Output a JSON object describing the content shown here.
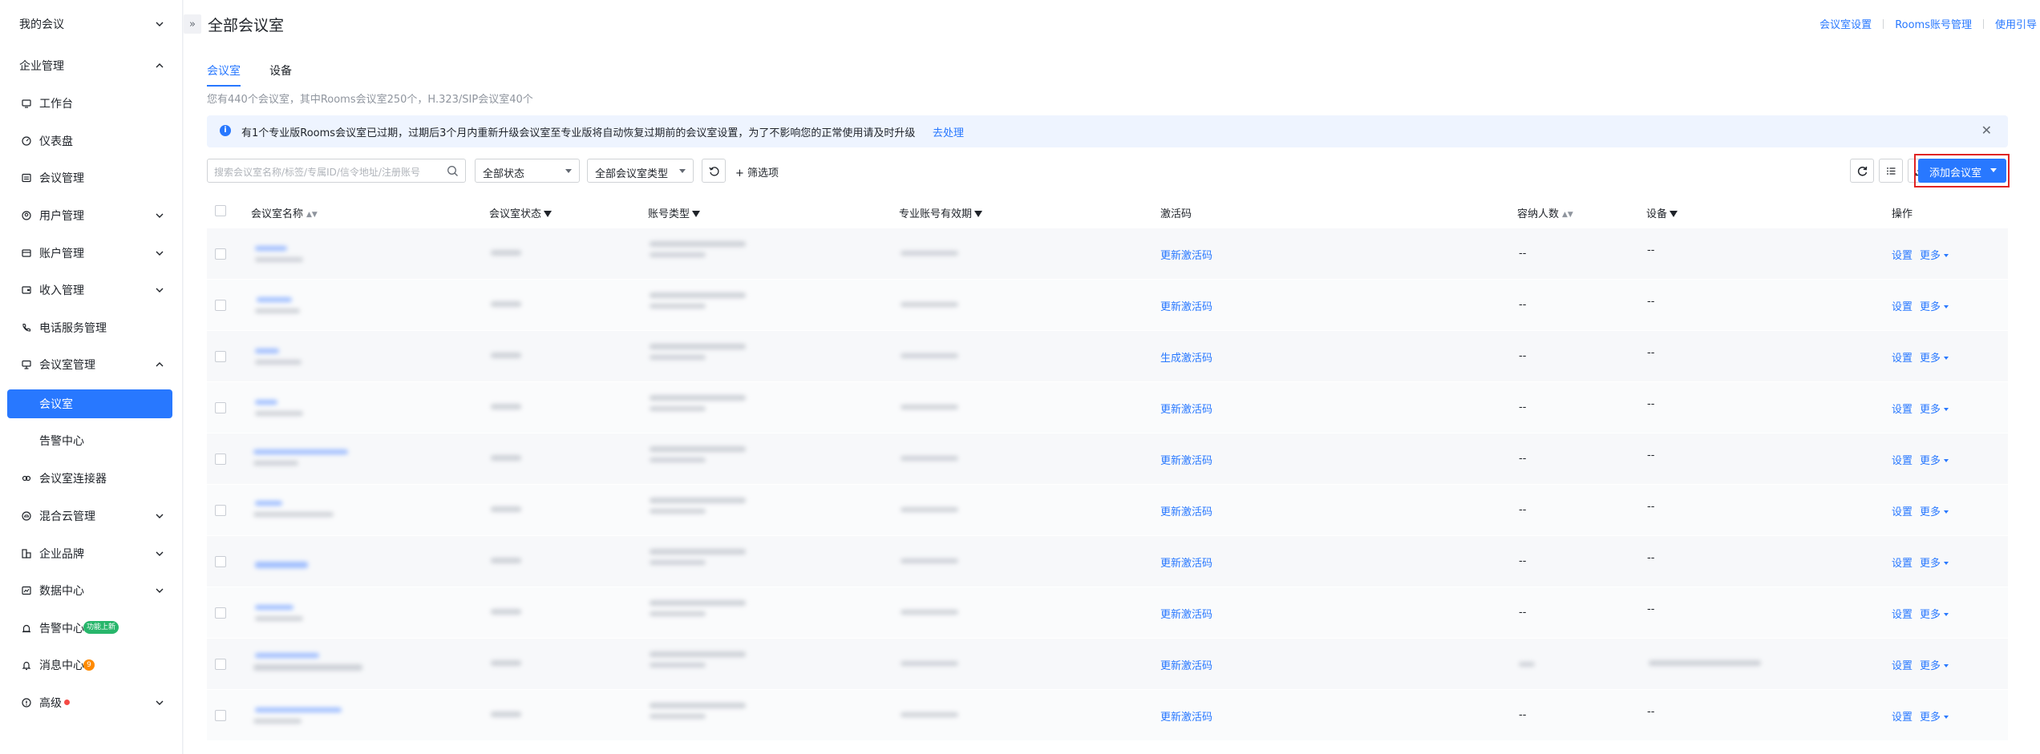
{
  "sidebar": {
    "my_meetings": "我的会议",
    "enterprise": "企业管理",
    "items": [
      {
        "label": "工作台",
        "icon": "workbench-icon",
        "chevron": false
      },
      {
        "label": "仪表盘",
        "icon": "dashboard-icon",
        "chevron": false
      },
      {
        "label": "会议管理",
        "icon": "meeting-list-icon",
        "chevron": false
      },
      {
        "label": "用户管理",
        "icon": "user-icon",
        "chevron": true
      },
      {
        "label": "账户管理",
        "icon": "account-icon",
        "chevron": true
      },
      {
        "label": "收入管理",
        "icon": "income-icon",
        "chevron": true
      },
      {
        "label": "电话服务管理",
        "icon": "phone-icon",
        "chevron": false
      },
      {
        "label": "会议室管理",
        "icon": "room-icon",
        "chevron": true
      }
    ],
    "sub_items": [
      {
        "label": "会议室",
        "active": true
      },
      {
        "label": "告警中心",
        "active": false
      }
    ],
    "items2": [
      {
        "label": "会议室连接器",
        "icon": "connector-icon",
        "chevron": false
      },
      {
        "label": "混合云管理",
        "icon": "cloud-icon",
        "chevron": true
      },
      {
        "label": "企业品牌",
        "icon": "brand-icon",
        "chevron": true
      },
      {
        "label": "数据中心",
        "icon": "data-icon",
        "chevron": true
      },
      {
        "label": "告警中心",
        "icon": "alarm-icon",
        "chevron": false
      },
      {
        "label": "消息中心",
        "icon": "bell-icon",
        "chevron": false
      },
      {
        "label": "高级",
        "icon": "advanced-icon",
        "chevron": true
      }
    ],
    "new_badge": "功能上新",
    "msg_count": "9"
  },
  "header": {
    "title": "全部会议室",
    "links": [
      "会议室设置",
      "Rooms账号管理",
      "使用引导"
    ]
  },
  "tabs": [
    "会议室",
    "设备"
  ],
  "summary": "您有440个会议室，其中Rooms会议室250个，H.323/SIP会议室40个",
  "notice": {
    "message": "有1个专业版Rooms会议室已过期，过期后3个月内重新升级会议室至专业版将自动恢复过期前的会议室设置，为了不影响您的正常使用请及时升级",
    "action": "去处理"
  },
  "toolbar": {
    "search_placeholder": "搜索会议室名称/标签/专属ID/信令地址/注册账号",
    "status_filter": "全部状态",
    "type_filter": "全部会议室类型",
    "filter_label": "筛选项",
    "add_button": "添加会议室"
  },
  "columns": {
    "name": "会议室名称",
    "status": "会议室状态",
    "account_type": "账号类型",
    "expiry": "专业账号有效期",
    "activation": "激活码",
    "capacity": "容纳人数",
    "device": "设备",
    "ops": "操作"
  },
  "rows": [
    {
      "activation": "更新激活码",
      "capacity": "--",
      "device": "--"
    },
    {
      "activation": "更新激活码",
      "capacity": "--",
      "device": "--"
    },
    {
      "activation": "生成激活码",
      "capacity": "--",
      "device": "--"
    },
    {
      "activation": "更新激活码",
      "capacity": "--",
      "device": "--"
    },
    {
      "activation": "更新激活码",
      "capacity": "--",
      "device": "--"
    },
    {
      "activation": "更新激活码",
      "capacity": "--",
      "device": "--"
    },
    {
      "activation": "更新激活码",
      "capacity": "--",
      "device": "--"
    },
    {
      "activation": "更新激活码",
      "capacity": "--",
      "device": "--"
    },
    {
      "activation": "更新激活码",
      "capacity": "",
      "device": ""
    },
    {
      "activation": "更新激活码",
      "capacity": "--",
      "device": "--"
    }
  ],
  "row_ops": {
    "settings": "设置",
    "more": "更多"
  },
  "colors": {
    "accent": "#2878ff",
    "highlight_border": "#e02424"
  }
}
